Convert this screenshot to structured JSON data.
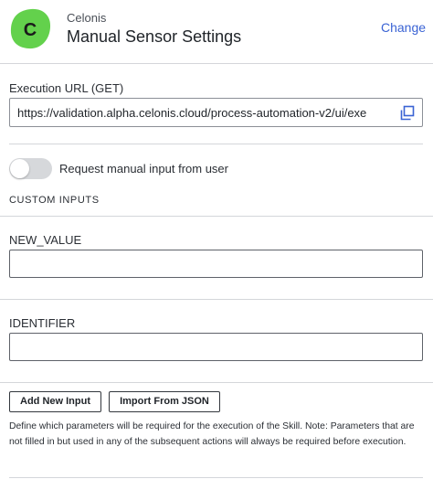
{
  "header": {
    "logo_letter": "C",
    "brand": "Celonis",
    "title": "Manual Sensor Settings",
    "change_label": "Change"
  },
  "execution_url": {
    "label": "Execution URL (GET)",
    "value": "https://validation.alpha.celonis.cloud/process-automation-v2/ui/exe",
    "copy_icon": "copy-icon"
  },
  "manual_input": {
    "label": "Request manual input from user",
    "enabled": false
  },
  "custom_inputs": {
    "section_title": "CUSTOM INPUTS",
    "inputs": [
      {
        "label": "NEW_VALUE",
        "value": ""
      },
      {
        "label": "IDENTIFIER",
        "value": ""
      }
    ]
  },
  "actions": {
    "add_label": "Add New Input",
    "import_label": "Import From JSON"
  },
  "help_text": "Define which parameters will be required for the execution of the Skill. Note: Parameters that are not filled in but used in any of the subsequent actions will always be required before execution.",
  "colors": {
    "logo_green": "#63d14c",
    "link_blue": "#3a63d4"
  }
}
